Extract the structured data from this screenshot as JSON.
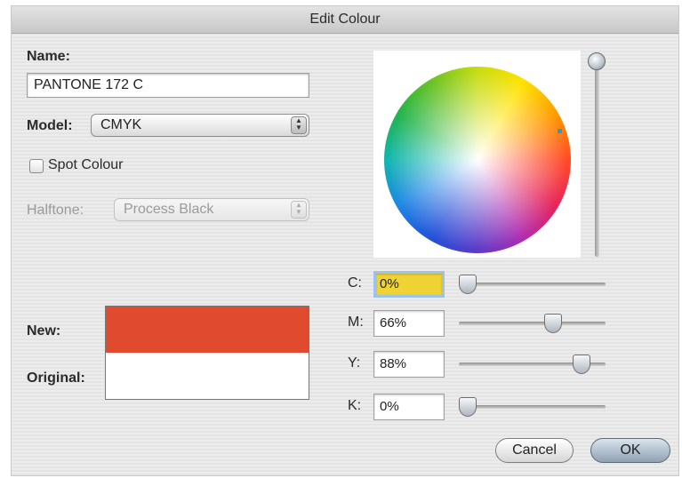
{
  "dialog": {
    "title": "Edit Colour"
  },
  "name": {
    "label": "Name:",
    "value": "PANTONE 172 C"
  },
  "model": {
    "label": "Model:",
    "value": "CMYK"
  },
  "spot_colour": {
    "label": "Spot Colour",
    "checked": false
  },
  "halftone": {
    "label": "Halftone:",
    "value": "Process Black",
    "enabled": false
  },
  "swatches": {
    "new_label": "New:",
    "original_label": "Original:",
    "new_color": "#e04a2e",
    "original_color": "#ffffff"
  },
  "wheel": {
    "icon": "color-wheel"
  },
  "channels": [
    {
      "label": "C:",
      "value": "0%",
      "level": 0.0
    },
    {
      "label": "M:",
      "value": "66%",
      "level": 0.66
    },
    {
      "label": "Y:",
      "value": "88%",
      "level": 0.88
    },
    {
      "label": "K:",
      "value": "0%",
      "level": 0.0
    }
  ],
  "buttons": {
    "cancel": "Cancel",
    "ok": "OK"
  }
}
